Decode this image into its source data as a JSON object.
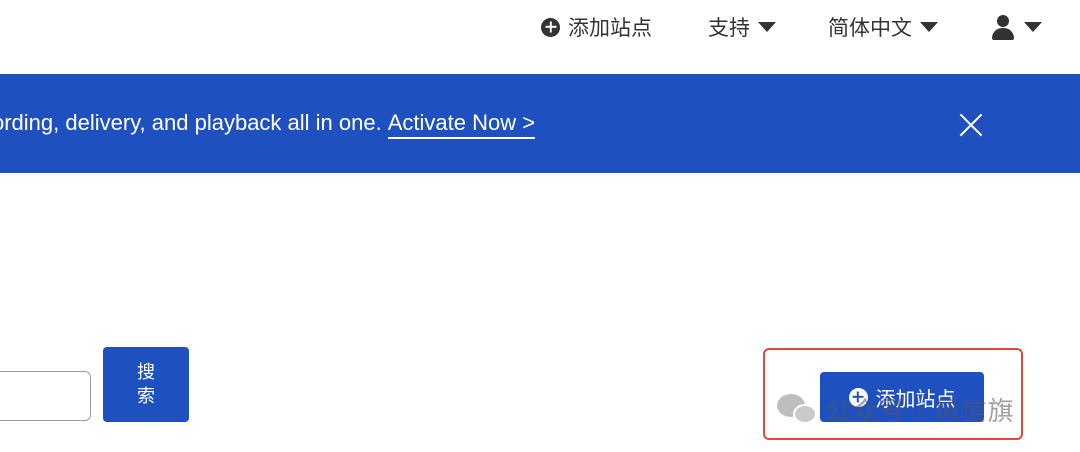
{
  "topnav": {
    "add_site_label": "添加站点",
    "support_label": "支持",
    "language_label": "简体中文"
  },
  "banner": {
    "text": "ording, delivery, and playback all in one.",
    "link_label": "Activate Now >"
  },
  "search": {
    "input_value": "",
    "button_label": "搜索"
  },
  "main": {
    "add_site_button_label": "添加站点"
  },
  "watermark": {
    "text": "公众号 · 风信旗"
  },
  "colors": {
    "brand_blue": "#1f50c0",
    "highlight_red": "#e0483c"
  }
}
